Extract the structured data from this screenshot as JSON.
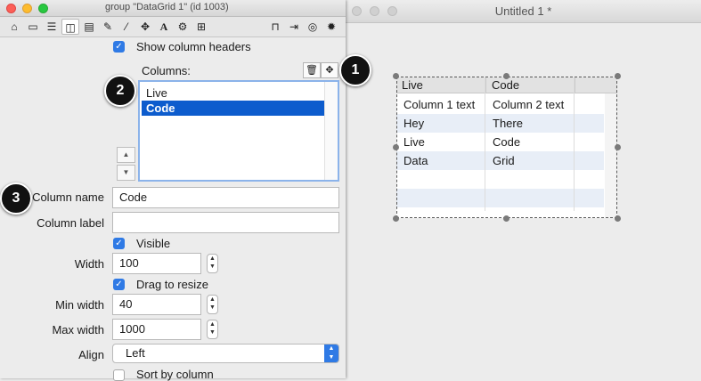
{
  "inspector": {
    "title": "group \"DataGrid 1\" (id 1003)",
    "toolbar_icons": [
      "home-icon",
      "card-icon",
      "list-icon",
      "columns-icon",
      "database-icon",
      "pencil-icon",
      "wand-icon",
      "move-icon",
      "text-icon",
      "gears-icon",
      "grid-icon",
      "lock-icon",
      "behavior-icon",
      "target-icon",
      "gear-icon"
    ],
    "show_column_headers": {
      "label": "Show column headers",
      "checked": true
    },
    "columns_label": "Columns:",
    "delete_icon": "trash-icon",
    "add_icon": "plus-icon",
    "columns": [
      {
        "label": "Live",
        "selected": false
      },
      {
        "label": "Code",
        "selected": true
      }
    ],
    "column_name": {
      "label": "Column name",
      "value": "Code"
    },
    "column_label": {
      "label": "Column label",
      "value": ""
    },
    "visible": {
      "label": "Visible",
      "checked": true
    },
    "width": {
      "label": "Width",
      "value": "100"
    },
    "drag_to_resize": {
      "label": "Drag to resize",
      "checked": true
    },
    "min_width": {
      "label": "Min width",
      "value": "40"
    },
    "max_width": {
      "label": "Max width",
      "value": "1000"
    },
    "align": {
      "label": "Align",
      "value": "Left"
    },
    "sort_by_column": {
      "label": "Sort by column",
      "checked": false
    }
  },
  "callouts": [
    "1",
    "2",
    "3"
  ],
  "document": {
    "title": "Untitled 1 *",
    "grid": {
      "headers": [
        "Live",
        "Code"
      ],
      "rows": [
        [
          "Column 1 text",
          "Column 2 text"
        ],
        [
          "Hey",
          "There"
        ],
        [
          "Live",
          "Code"
        ],
        [
          "Data",
          "Grid"
        ],
        [
          "",
          ""
        ],
        [
          "",
          ""
        ]
      ]
    }
  },
  "colors": {
    "accent": "#2f7ae5",
    "selection": "#0d5ccd",
    "alt_row": "#e8eef7"
  }
}
